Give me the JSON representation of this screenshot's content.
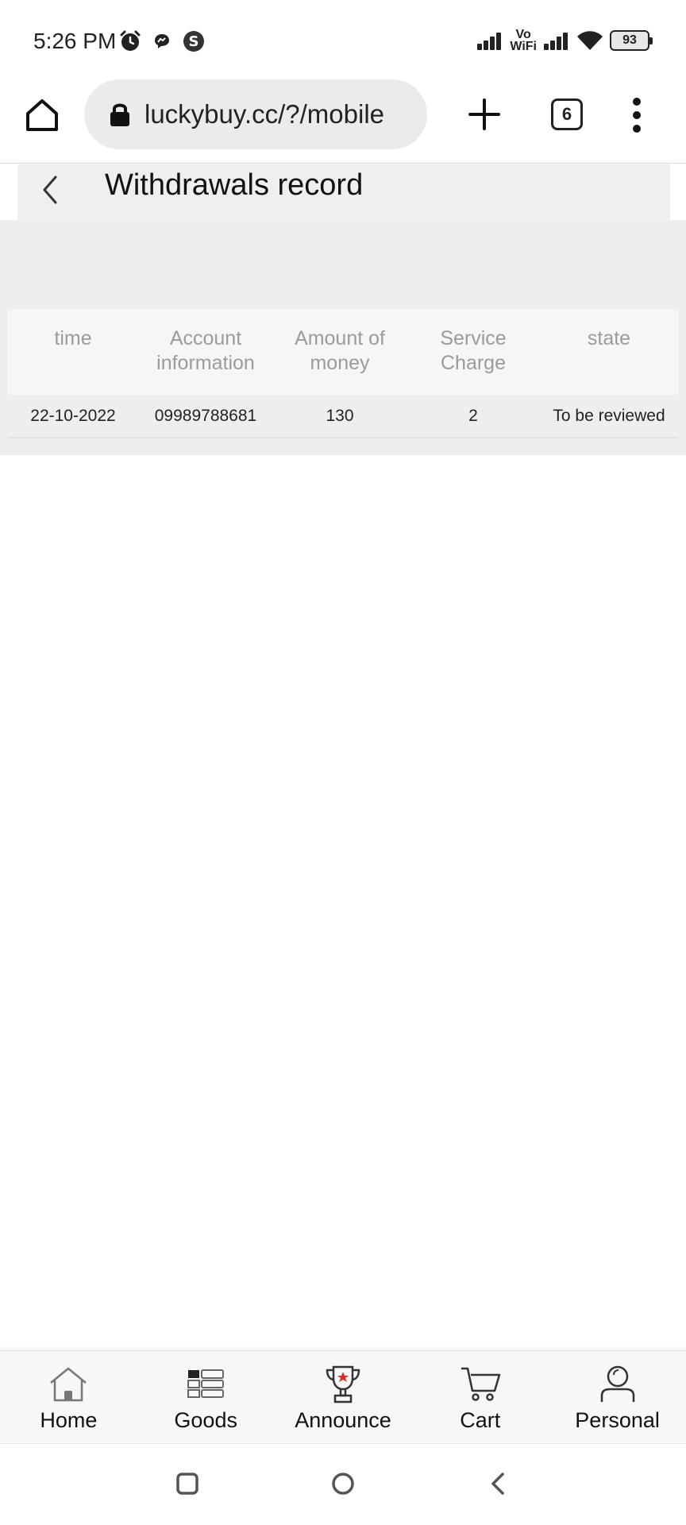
{
  "status_bar": {
    "time": "5:26 PM",
    "vowifi_top": "Vo",
    "vowifi_bottom": "WiFi",
    "battery": "93",
    "icons": [
      "alarm-icon",
      "messenger-icon",
      "s-app-icon",
      "signal-icon",
      "wifi-icon",
      "battery-icon"
    ]
  },
  "browser": {
    "url": "luckybuy.cc/?/mobile",
    "tab_count": "6",
    "icons": [
      "home-icon",
      "lock-icon",
      "plus-icon",
      "tabs-icon",
      "more-vert-icon"
    ]
  },
  "page": {
    "title": "Withdrawals record",
    "back_icon": "chevron-left-icon"
  },
  "table": {
    "headers": [
      "time",
      "Account information",
      "Amount of money",
      "Service Charge",
      "state"
    ],
    "rows": [
      [
        "22-10-2022",
        "09989788681",
        "130",
        "2",
        "To be reviewed"
      ]
    ]
  },
  "bottom_nav": {
    "items": [
      {
        "label": "Home",
        "icon": "home-outline-icon"
      },
      {
        "label": "Goods",
        "icon": "grid-list-icon"
      },
      {
        "label": "Announce",
        "icon": "trophy-icon"
      },
      {
        "label": "Cart",
        "icon": "cart-icon"
      },
      {
        "label": "Personal",
        "icon": "person-icon"
      }
    ]
  },
  "colors": {
    "header_bg": "#efefef",
    "table_head_text": "#9b9b9b",
    "trophy_star": "#d0312d"
  }
}
